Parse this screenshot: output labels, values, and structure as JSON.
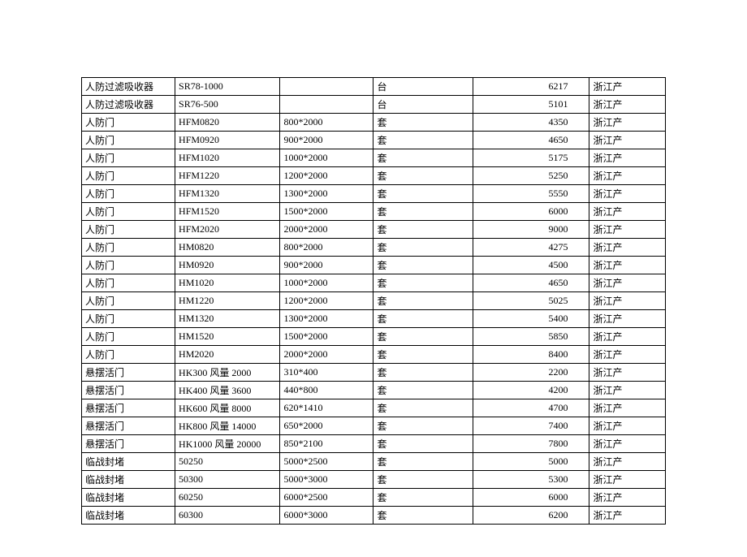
{
  "rows": [
    {
      "name": "人防过滤吸收器",
      "model": "SR78-1000",
      "spec": "",
      "unit": "台",
      "price": "6217",
      "origin": "浙江产"
    },
    {
      "name": "人防过滤吸收器",
      "model": "SR76-500",
      "spec": "",
      "unit": "台",
      "price": "5101",
      "origin": "浙江产"
    },
    {
      "name": "人防门",
      "model": "HFM0820",
      "spec": "800*2000",
      "unit": "套",
      "price": "4350",
      "origin": "浙江产"
    },
    {
      "name": "人防门",
      "model": "HFM0920",
      "spec": "900*2000",
      "unit": "套",
      "price": "4650",
      "origin": "浙江产"
    },
    {
      "name": "人防门",
      "model": "HFM1020",
      "spec": "1000*2000",
      "unit": "套",
      "price": "5175",
      "origin": "浙江产"
    },
    {
      "name": "人防门",
      "model": "HFM1220",
      "spec": "1200*2000",
      "unit": "套",
      "price": "5250",
      "origin": "浙江产"
    },
    {
      "name": "人防门",
      "model": "HFM1320",
      "spec": "1300*2000",
      "unit": "套",
      "price": "5550",
      "origin": "浙江产"
    },
    {
      "name": "人防门",
      "model": "HFM1520",
      "spec": "1500*2000",
      "unit": "套",
      "price": "6000",
      "origin": "浙江产"
    },
    {
      "name": "人防门",
      "model": "HFM2020",
      "spec": "2000*2000",
      "unit": "套",
      "price": "9000",
      "origin": "浙江产"
    },
    {
      "name": "人防门",
      "model": "HM0820",
      "spec": "800*2000",
      "unit": "套",
      "price": "4275",
      "origin": "浙江产"
    },
    {
      "name": "人防门",
      "model": "HM0920",
      "spec": "900*2000",
      "unit": "套",
      "price": "4500",
      "origin": "浙江产"
    },
    {
      "name": "人防门",
      "model": "HM1020",
      "spec": "1000*2000",
      "unit": "套",
      "price": "4650",
      "origin": "浙江产"
    },
    {
      "name": "人防门",
      "model": "HM1220",
      "spec": "1200*2000",
      "unit": "套",
      "price": "5025",
      "origin": "浙江产"
    },
    {
      "name": "人防门",
      "model": "HM1320",
      "spec": "1300*2000",
      "unit": "套",
      "price": "5400",
      "origin": "浙江产"
    },
    {
      "name": "人防门",
      "model": "HM1520",
      "spec": "1500*2000",
      "unit": "套",
      "price": "5850",
      "origin": "浙江产"
    },
    {
      "name": "人防门",
      "model": "HM2020",
      "spec": "2000*2000",
      "unit": "套",
      "price": "8400",
      "origin": "浙江产"
    },
    {
      "name": "悬摆活门",
      "model": "HK300   风量 2000",
      "spec": "310*400",
      "unit": "套",
      "price": "2200",
      "origin": "浙江产"
    },
    {
      "name": "悬摆活门",
      "model": "HK400   风量 3600",
      "spec": "440*800",
      "unit": "套",
      "price": "4200",
      "origin": "浙江产"
    },
    {
      "name": "悬摆活门",
      "model": "HK600   风量 8000",
      "spec": "620*1410",
      "unit": "套",
      "price": "4700",
      "origin": "浙江产"
    },
    {
      "name": "悬摆活门",
      "model": "HK800   风量 14000",
      "spec": "650*2000",
      "unit": "套",
      "price": "7400",
      "origin": "浙江产"
    },
    {
      "name": "悬摆活门",
      "model": "HK1000  风量 20000",
      "spec": "850*2100",
      "unit": "套",
      "price": "7800",
      "origin": "浙江产"
    },
    {
      "name": "临战封堵",
      "model": "50250",
      "spec": "5000*2500",
      "unit": "套",
      "price": "5000",
      "origin": "浙江产"
    },
    {
      "name": "临战封堵",
      "model": "50300",
      "spec": "5000*3000",
      "unit": "套",
      "price": "5300",
      "origin": "浙江产"
    },
    {
      "name": "临战封堵",
      "model": "60250",
      "spec": "6000*2500",
      "unit": "套",
      "price": "6000",
      "origin": "浙江产"
    },
    {
      "name": "临战封堵",
      "model": "60300",
      "spec": "6000*3000",
      "unit": "套",
      "price": "6200",
      "origin": "浙江产"
    }
  ]
}
